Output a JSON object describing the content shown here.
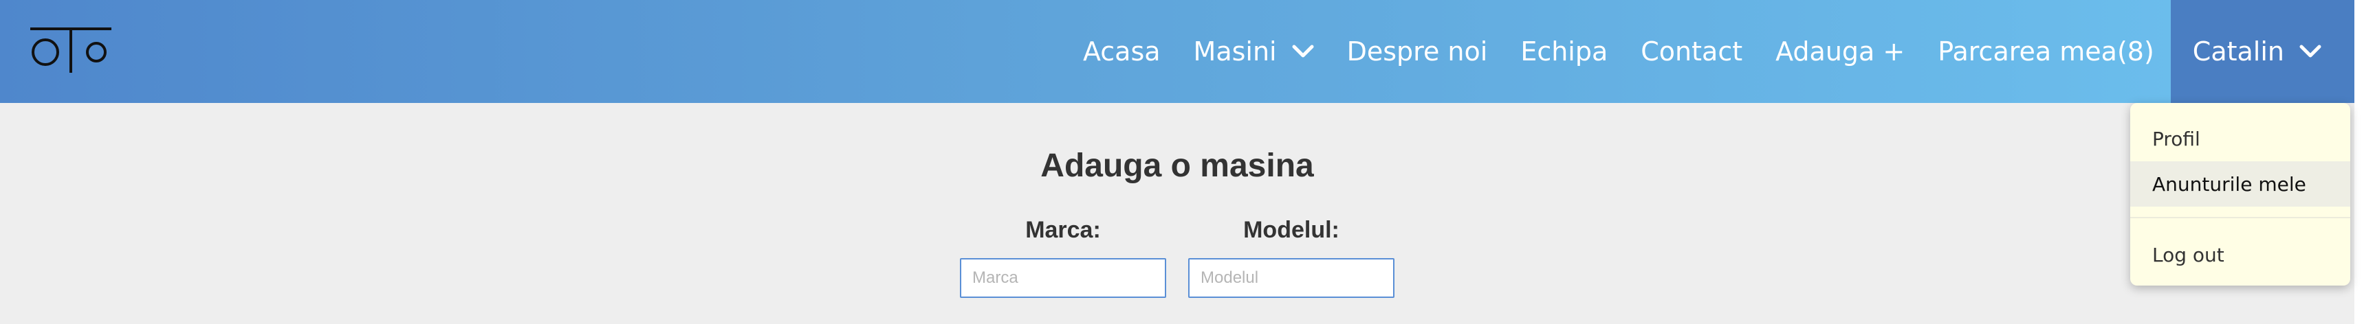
{
  "nav": {
    "items": [
      {
        "label": "Acasa"
      },
      {
        "label": "Masini"
      },
      {
        "label": "Despre noi"
      },
      {
        "label": "Echipa"
      },
      {
        "label": "Contact"
      },
      {
        "label": "Adauga +"
      },
      {
        "label": "Parcarea mea(8)"
      }
    ],
    "user_label": "Catalin"
  },
  "dropdown": {
    "items": [
      {
        "label": "Profil"
      },
      {
        "label": "Anunturile mele"
      },
      {
        "label": "Log out"
      }
    ]
  },
  "form": {
    "title": "Adauga o masina",
    "brand_label": "Marca:",
    "brand_placeholder": "Marca",
    "model_label": "Modelul:",
    "model_placeholder": "Modelul"
  }
}
